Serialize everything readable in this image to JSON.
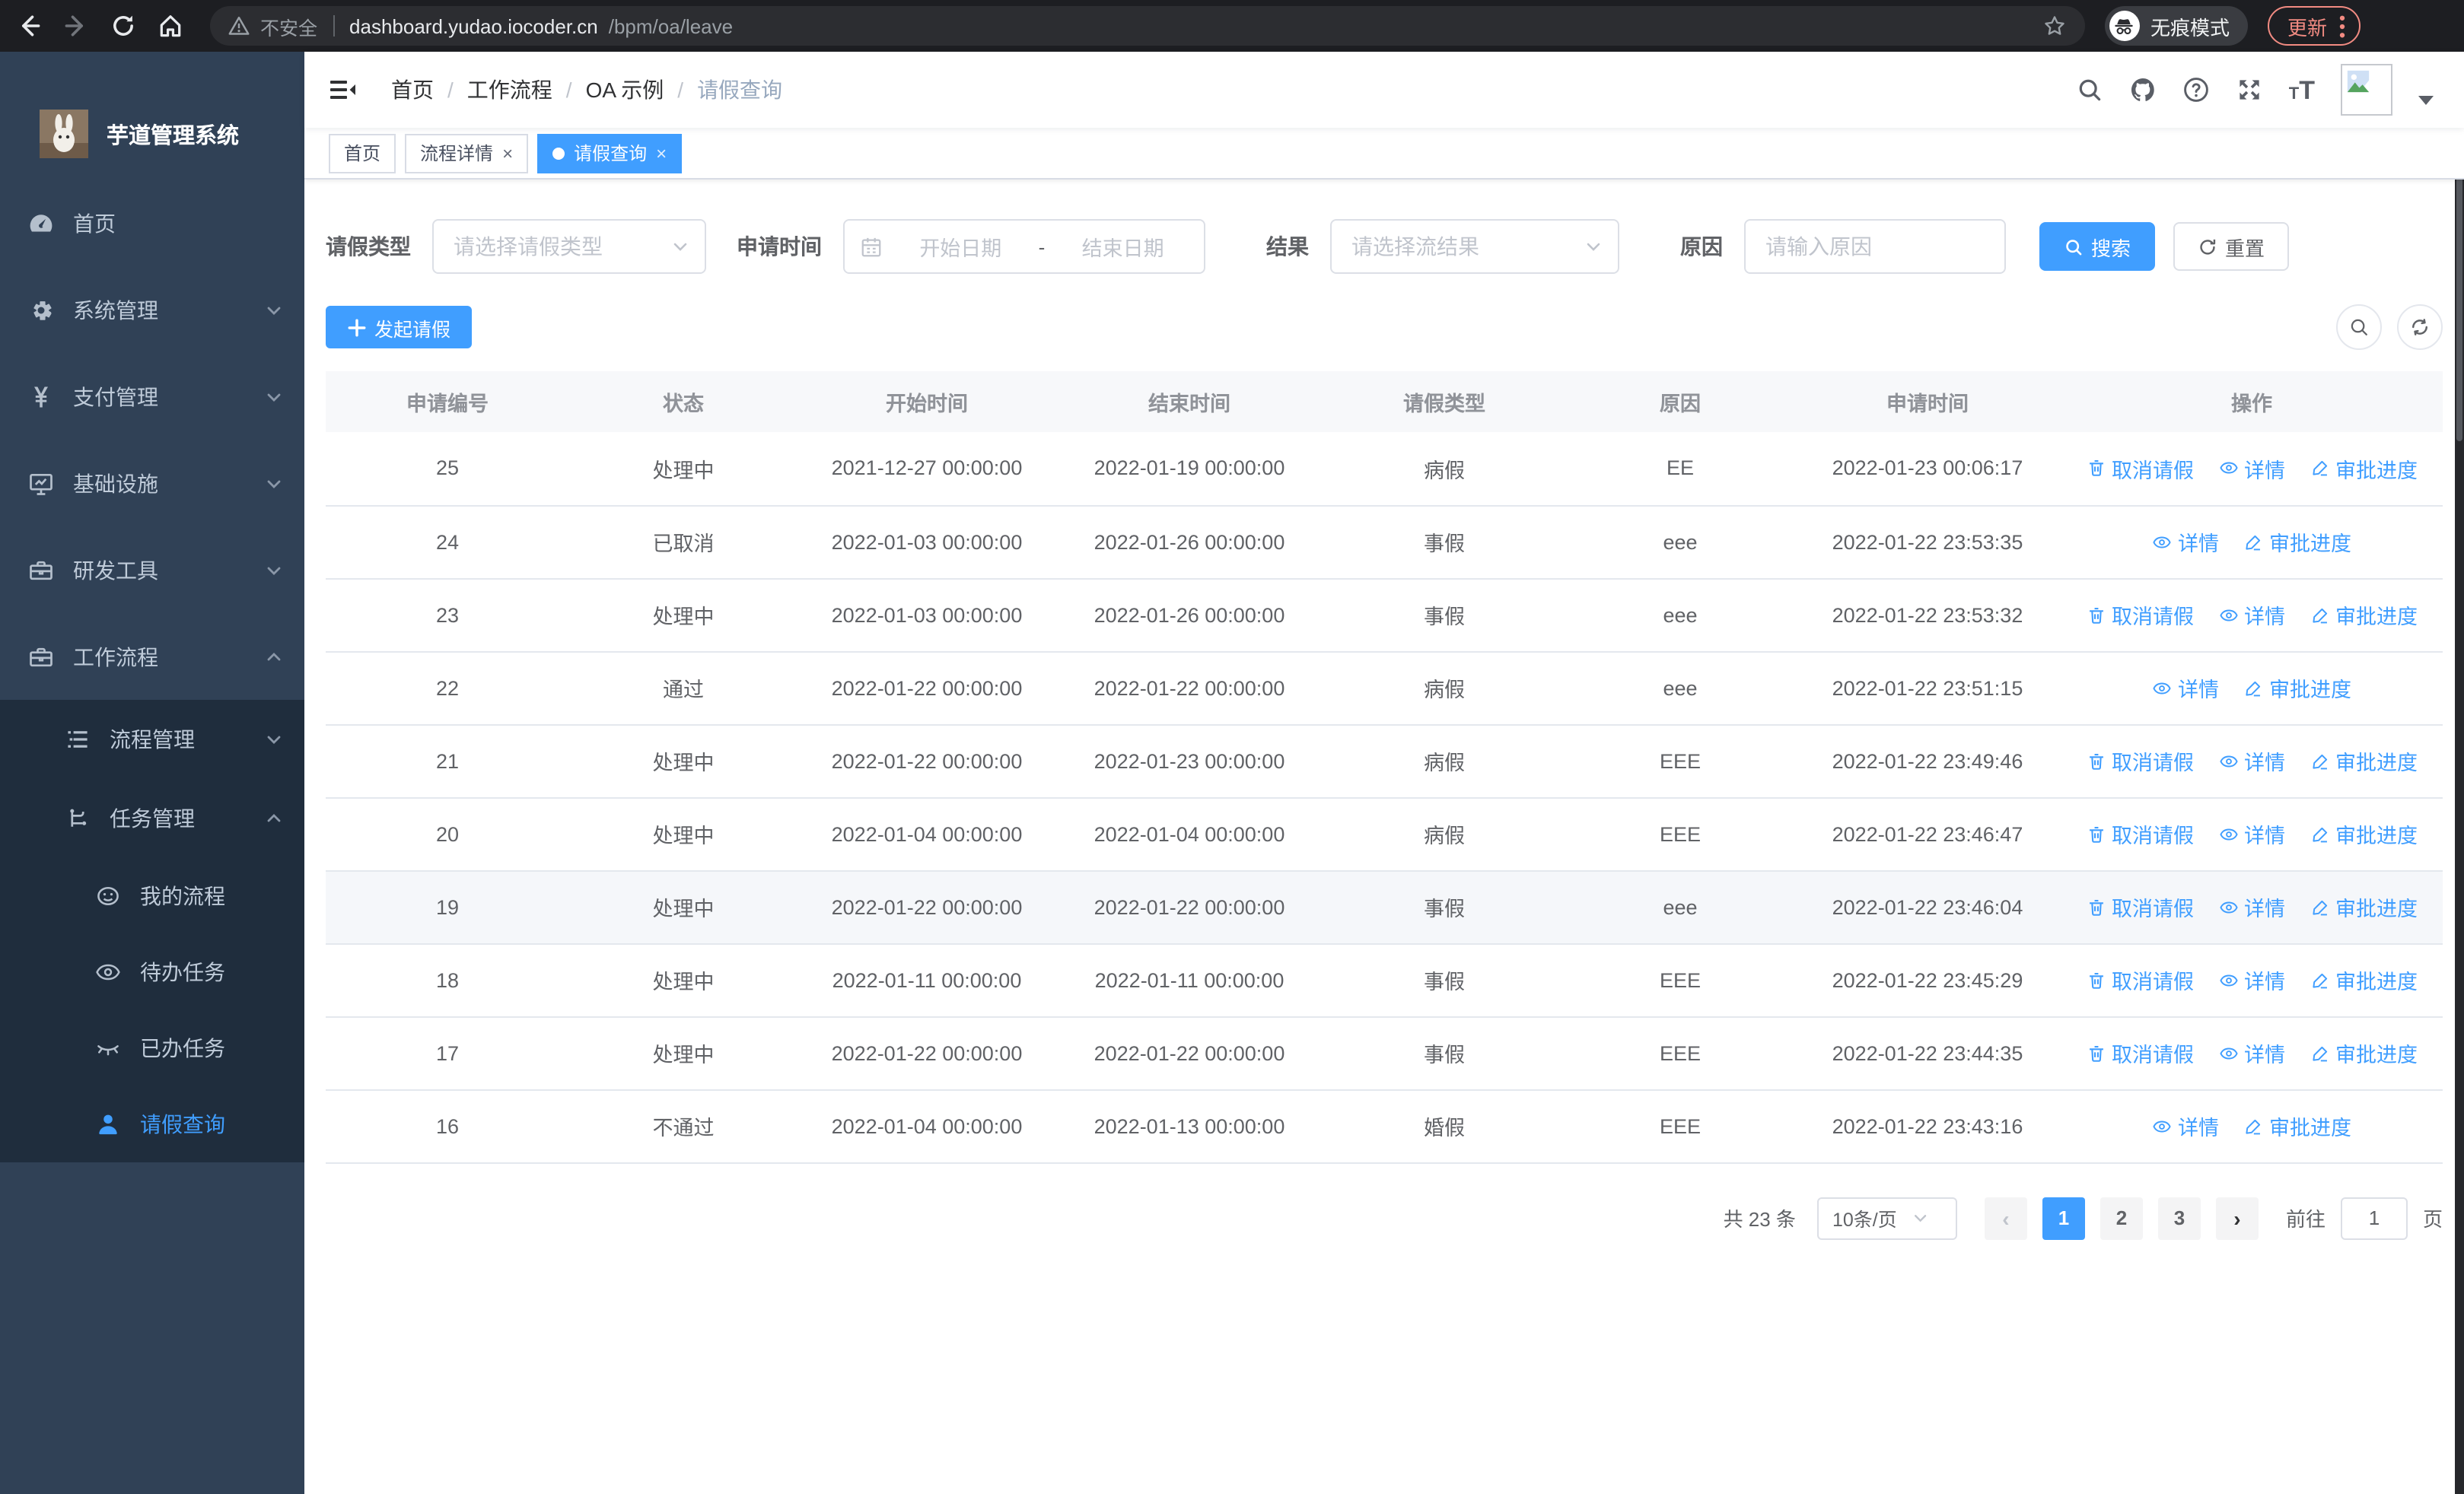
{
  "browser": {
    "security_label": "不安全",
    "url_host": "dashboard.yudao.iocoder.cn",
    "url_path": "/bpm/oa/leave",
    "incognito_label": "无痕模式",
    "update_label": "更新"
  },
  "sidebar": {
    "title": "芋道管理系统",
    "menu": [
      {
        "label": "首页",
        "icon": "dashboard-icon"
      },
      {
        "label": "系统管理",
        "icon": "gear-icon"
      },
      {
        "label": "支付管理",
        "icon": "yen-icon"
      },
      {
        "label": "基础设施",
        "icon": "monitor-icon"
      },
      {
        "label": "研发工具",
        "icon": "toolbox-icon"
      },
      {
        "label": "工作流程",
        "icon": "toolbox-icon"
      }
    ],
    "submenu": {
      "process_mgmt": {
        "label": "流程管理",
        "icon": "tree-list-icon"
      },
      "task_mgmt": {
        "label": "任务管理",
        "icon": "flow-branch-icon"
      },
      "children": [
        {
          "label": "我的流程",
          "icon": "face-icon"
        },
        {
          "label": "待办任务",
          "icon": "eye-icon"
        },
        {
          "label": "已办任务",
          "icon": "eye-closed-icon"
        },
        {
          "label": "请假查询",
          "icon": "user-icon",
          "active": true
        }
      ]
    }
  },
  "navbar": {
    "breadcrumb": [
      "首页",
      "工作流程",
      "OA 示例",
      "请假查询"
    ]
  },
  "tags": [
    {
      "label": "首页",
      "closable": false,
      "active": false
    },
    {
      "label": "流程详情",
      "closable": true,
      "active": false
    },
    {
      "label": "请假查询",
      "closable": true,
      "active": true
    }
  ],
  "filters": {
    "leave_type_label": "请假类型",
    "leave_type_placeholder": "请选择请假类型",
    "apply_time_label": "申请时间",
    "date_start_placeholder": "开始日期",
    "date_separator": "-",
    "date_end_placeholder": "结束日期",
    "result_label": "结果",
    "result_placeholder": "请选择流结果",
    "reason_label": "原因",
    "reason_placeholder": "请输入原因",
    "search_label": "搜索",
    "reset_label": "重置"
  },
  "toolbar": {
    "create_label": "发起请假"
  },
  "table": {
    "columns": [
      "申请编号",
      "状态",
      "开始时间",
      "结束时间",
      "请假类型",
      "原因",
      "申请时间",
      "操作"
    ],
    "action_labels": {
      "cancel": "取消请假",
      "detail": "详情",
      "progress": "审批进度"
    },
    "rows": [
      {
        "id": "25",
        "status": "处理中",
        "start": "2021-12-27 00:00:00",
        "end": "2022-01-19 00:00:00",
        "type": "病假",
        "reason": "EE",
        "applied": "2022-01-23 00:06:17",
        "actions": [
          "cancel",
          "detail",
          "progress"
        ],
        "hover": false
      },
      {
        "id": "24",
        "status": "已取消",
        "start": "2022-01-03 00:00:00",
        "end": "2022-01-26 00:00:00",
        "type": "事假",
        "reason": "eee",
        "applied": "2022-01-22 23:53:35",
        "actions": [
          "detail",
          "progress"
        ],
        "hover": false
      },
      {
        "id": "23",
        "status": "处理中",
        "start": "2022-01-03 00:00:00",
        "end": "2022-01-26 00:00:00",
        "type": "事假",
        "reason": "eee",
        "applied": "2022-01-22 23:53:32",
        "actions": [
          "cancel",
          "detail",
          "progress"
        ],
        "hover": false
      },
      {
        "id": "22",
        "status": "通过",
        "start": "2022-01-22 00:00:00",
        "end": "2022-01-22 00:00:00",
        "type": "病假",
        "reason": "eee",
        "applied": "2022-01-22 23:51:15",
        "actions": [
          "detail",
          "progress"
        ],
        "hover": false
      },
      {
        "id": "21",
        "status": "处理中",
        "start": "2022-01-22 00:00:00",
        "end": "2022-01-23 00:00:00",
        "type": "病假",
        "reason": "EEE",
        "applied": "2022-01-22 23:49:46",
        "actions": [
          "cancel",
          "detail",
          "progress"
        ],
        "hover": false
      },
      {
        "id": "20",
        "status": "处理中",
        "start": "2022-01-04 00:00:00",
        "end": "2022-01-04 00:00:00",
        "type": "病假",
        "reason": "EEE",
        "applied": "2022-01-22 23:46:47",
        "actions": [
          "cancel",
          "detail",
          "progress"
        ],
        "hover": false
      },
      {
        "id": "19",
        "status": "处理中",
        "start": "2022-01-22 00:00:00",
        "end": "2022-01-22 00:00:00",
        "type": "事假",
        "reason": "eee",
        "applied": "2022-01-22 23:46:04",
        "actions": [
          "cancel",
          "detail",
          "progress"
        ],
        "hover": true
      },
      {
        "id": "18",
        "status": "处理中",
        "start": "2022-01-11 00:00:00",
        "end": "2022-01-11 00:00:00",
        "type": "事假",
        "reason": "EEE",
        "applied": "2022-01-22 23:45:29",
        "actions": [
          "cancel",
          "detail",
          "progress"
        ],
        "hover": false
      },
      {
        "id": "17",
        "status": "处理中",
        "start": "2022-01-22 00:00:00",
        "end": "2022-01-22 00:00:00",
        "type": "事假",
        "reason": "EEE",
        "applied": "2022-01-22 23:44:35",
        "actions": [
          "cancel",
          "detail",
          "progress"
        ],
        "hover": false
      },
      {
        "id": "16",
        "status": "不通过",
        "start": "2022-01-04 00:00:00",
        "end": "2022-01-13 00:00:00",
        "type": "婚假",
        "reason": "EEE",
        "applied": "2022-01-22 23:43:16",
        "actions": [
          "detail",
          "progress"
        ],
        "hover": false
      }
    ]
  },
  "pagination": {
    "total_label": "共 23 条",
    "page_size": "10条/页",
    "pages": [
      "1",
      "2",
      "3"
    ],
    "active_page": "1",
    "prev_enabled": false,
    "goto_label": "前往",
    "goto_value": "1",
    "page_unit_label": "页"
  },
  "colors": {
    "accent": "#409EFF",
    "sidebar_bg": "#304156",
    "submenu_bg": "#1F2D3D",
    "update_pill": "#F28B82"
  }
}
